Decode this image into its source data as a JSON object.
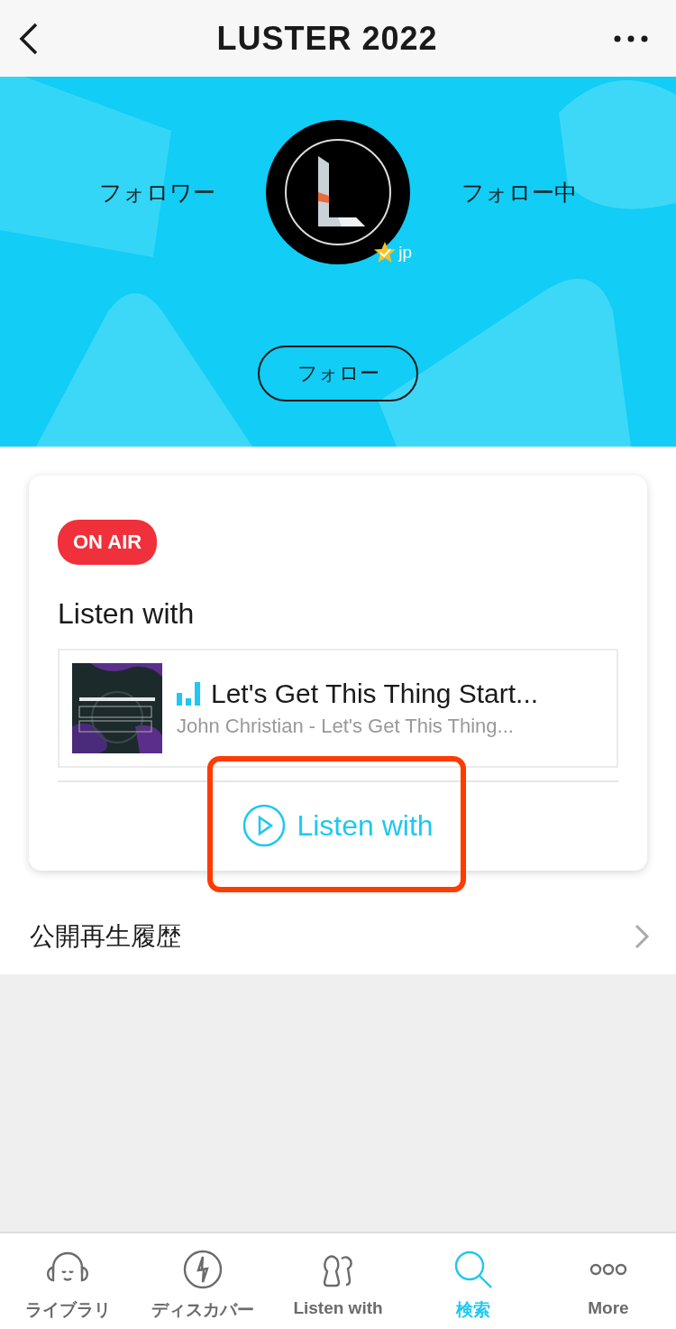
{
  "header": {
    "title": "LUSTER 2022"
  },
  "profile": {
    "followers_label": "フォロワー",
    "following_label": "フォロー中",
    "region": "jp",
    "verified": true,
    "follow_button": "フォロー"
  },
  "live_card": {
    "badge": "ON AIR",
    "title": "Listen with",
    "playing": true,
    "track": {
      "title": "Let's Get This Thing Start...",
      "subtitle": "John Christian - Let's Get This Thing..."
    },
    "listen_button": "Listen with",
    "highlighted": true
  },
  "history": {
    "label": "公開再生履歴"
  },
  "tab_bar": [
    {
      "kind": "library",
      "label": "ライブラリ",
      "selected": false
    },
    {
      "kind": "discover",
      "label": "ディスカバー",
      "selected": false
    },
    {
      "kind": "listen",
      "label": "Listen with",
      "selected": false
    },
    {
      "kind": "search",
      "label": "検索",
      "selected": true
    },
    {
      "kind": "more",
      "label": "More",
      "selected": false
    }
  ]
}
